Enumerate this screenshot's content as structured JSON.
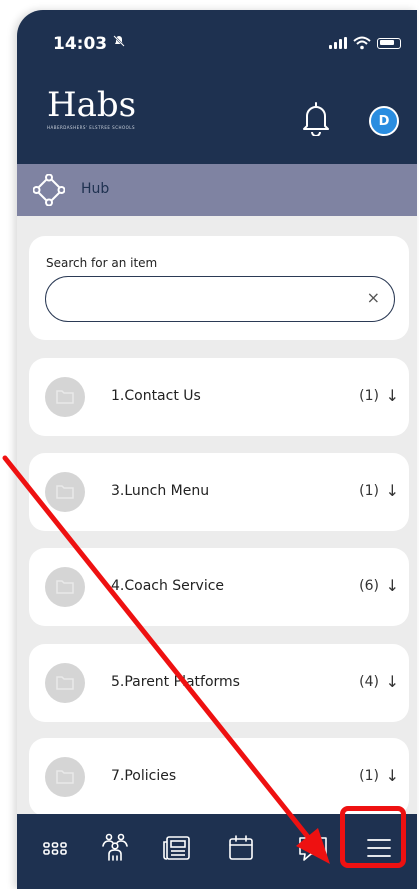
{
  "status_bar": {
    "time": "14:03"
  },
  "header": {
    "logo_text": "Habs",
    "logo_subtext": "HABERDASHERS' ELSTREE SCHOOLS",
    "avatar_initial": "D"
  },
  "subheader": {
    "title": "Hub"
  },
  "search": {
    "label": "Search for an item",
    "value": "",
    "placeholder": "",
    "clear": "×"
  },
  "items": [
    {
      "label": "1.Contact Us",
      "count": "(1)"
    },
    {
      "label": "3.Lunch Menu",
      "count": "(1)"
    },
    {
      "label": "4.Coach Service",
      "count": "(6)"
    },
    {
      "label": "5.Parent Platforms",
      "count": "(4)"
    },
    {
      "label": "7.Policies",
      "count": "(1)"
    }
  ],
  "arrow_glyph": "↓",
  "bottom_nav": [
    "grid-icon",
    "community-icon",
    "news-icon",
    "calendar-icon",
    "chat-icon",
    "menu-icon"
  ],
  "colors": {
    "primary": "#1e3150",
    "subheader": "#7f83a2",
    "accent_blue": "#2a8de0",
    "annotation_red": "#ee1111",
    "background": "#ececec"
  }
}
